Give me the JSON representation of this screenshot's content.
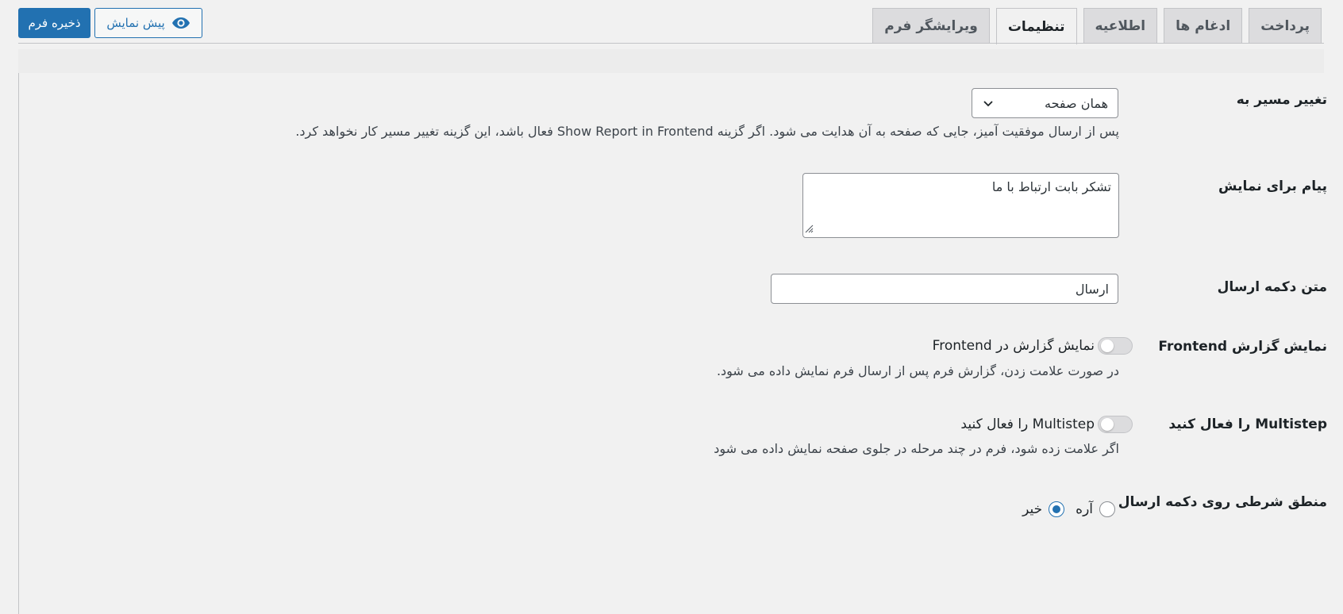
{
  "tabs": [
    {
      "label": "ویرایشگر فرم",
      "active": false
    },
    {
      "label": "تنظیمات",
      "active": true
    },
    {
      "label": "اطلاعیه",
      "active": false
    },
    {
      "label": "ادغام ها",
      "active": false
    },
    {
      "label": "پرداخت",
      "active": false
    }
  ],
  "toolbar": {
    "save_label": "ذخیره فرم",
    "preview_label": "پیش نمایش"
  },
  "colors": {
    "accent": "#2271b1",
    "background": "#f1f1f1"
  },
  "settings": {
    "redirect": {
      "label": "تغییر مسیر به",
      "value": "همان صفحه",
      "description": "پس از ارسال موفقیت آمیز، جایی که صفحه به آن هدایت می شود. اگر گزینه Show Report in Frontend فعال باشد، این گزینه تغییر مسیر کار نخواهد کرد."
    },
    "message": {
      "label": "پیام برای نمایش",
      "value": "تشکر بابت ارتباط با ما"
    },
    "submit_text": {
      "label": "متن دکمه ارسال",
      "value": "ارسال"
    },
    "frontend_report": {
      "label": "نمایش گزارش Frontend",
      "toggle_label": "نمایش گزارش در Frontend",
      "description": "در صورت علامت زدن، گزارش فرم پس از ارسال فرم نمایش داده می شود.",
      "enabled": false
    },
    "multistep": {
      "label": "Multistep را فعال کنید",
      "toggle_label": "Multistep را فعال کنید",
      "description": "اگر علامت زده شود، فرم در چند مرحله در جلوی صفحه نمایش داده می شود",
      "enabled": false
    },
    "conditional_logic": {
      "label": "منطق شرطی روی دکمه ارسال",
      "options": [
        {
          "label": "آره",
          "checked": false
        },
        {
          "label": "خیر",
          "checked": true
        }
      ]
    }
  }
}
